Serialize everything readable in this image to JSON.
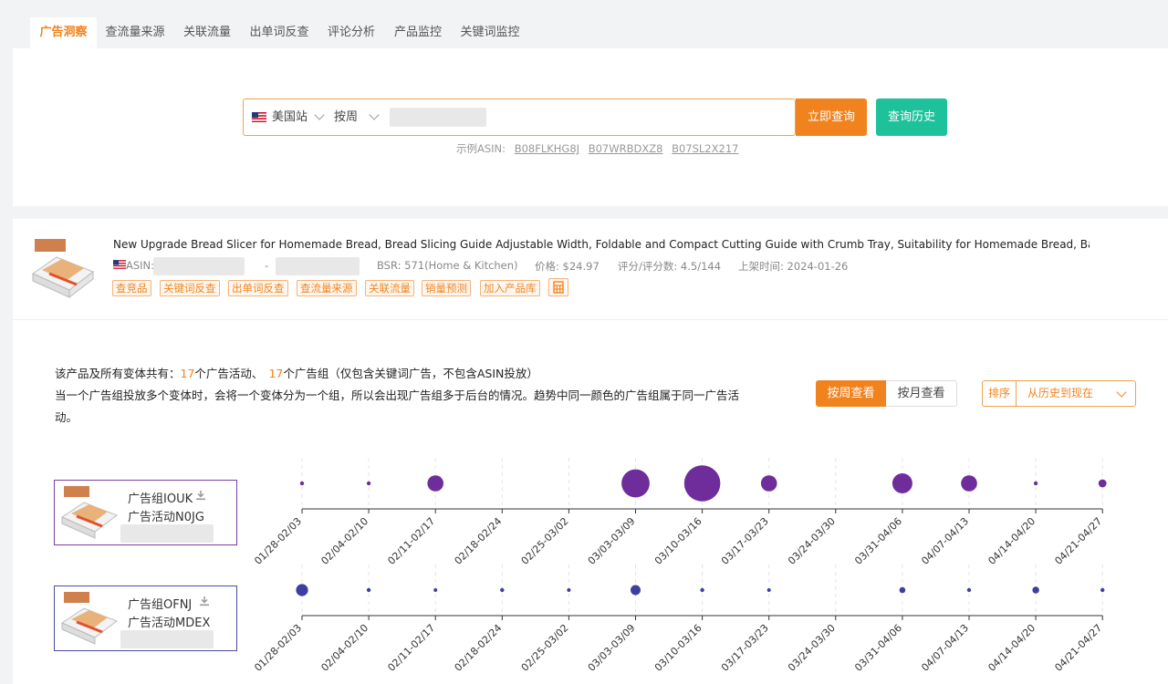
{
  "tabs": [
    {
      "label": "广告洞察",
      "active": true
    },
    {
      "label": "查流量来源",
      "active": false
    },
    {
      "label": "关联流量",
      "active": false
    },
    {
      "label": "出单词反查",
      "active": false
    },
    {
      "label": "评论分析",
      "active": false
    },
    {
      "label": "产品监控",
      "active": false
    },
    {
      "label": "关键词监控",
      "active": false
    }
  ],
  "search": {
    "marketplace": "美国站",
    "period": "按周",
    "query_button": "立即查询",
    "history_button": "查询历史",
    "examples_label": "示例ASIN:",
    "example_asins": [
      "B08FLKHG8J",
      "B07WRBDXZ8",
      "B07SL2X217"
    ]
  },
  "product": {
    "title": "New Upgrade Bread Slicer for Homemade Bread, Bread Slicing Guide Adjustable Width, Foldable and Compact Cutting Guide with Crumb Tray, Suitability for Homemade Bread, Bag...",
    "asin_label": "ASIN:",
    "dash": "-",
    "bsr": "BSR: 571(Home & Kitchen)",
    "price": "价格: $24.97",
    "rating": "评分/评分数: 4.5/144",
    "launch": "上架时间: 2024-01-26",
    "tags": [
      "查竞品",
      "关键词反查",
      "出单词反查",
      "查流量来源",
      "关联流量",
      "销量预测",
      "加入产品库"
    ]
  },
  "summary": {
    "prefix": "该产品及所有变体共有：",
    "campaign_count": "17",
    "campaign_text": "个广告活动、",
    "group_count": "17",
    "group_text": "个广告组（仅包含关键词广告，不包含ASIN投放）",
    "line2": "当一个广告组投放多个变体时，会将一个变体分为一个组，所以会出现广告组多于后台的情况。趋势中同一颜色的广告组属于同一广告活",
    "line3": "动。"
  },
  "view_toggle": {
    "week": "按周查看",
    "month": "按月查看"
  },
  "sort": {
    "label": "排序",
    "value": "从历史到现在"
  },
  "colors": {
    "accent": "#f0831e",
    "teal": "#1dc29b",
    "purple": "#6f2d9c",
    "blue": "#3d3f9e"
  },
  "groups": [
    {
      "name": "广告组IOUK",
      "campaign": "广告活动N0JG"
    },
    {
      "name": "广告组OFNJ",
      "campaign": "广告活动MDEX"
    }
  ],
  "chart_data": {
    "type": "scatter",
    "categories": [
      "01/28-02/03",
      "02/04-02/10",
      "02/11-02/17",
      "02/18-02/24",
      "02/25-03/02",
      "03/03-03/09",
      "03/10-03/16",
      "03/17-03/23",
      "03/24-03/30",
      "03/31-04/06",
      "04/07-04/13",
      "04/14-04/20",
      "04/21-04/27"
    ],
    "series": [
      {
        "group": "广告组IOUK",
        "color": "#6f2d9c",
        "sizes": [
          1,
          1,
          4,
          null,
          null,
          7,
          9,
          4,
          null,
          5,
          4,
          1,
          2
        ]
      },
      {
        "group": "广告组OFNJ",
        "color": "#3d3f9e",
        "sizes": [
          3,
          1,
          0.5,
          1,
          0.5,
          2.5,
          1,
          0.5,
          null,
          1.5,
          1,
          1.7,
          1
        ]
      }
    ]
  }
}
